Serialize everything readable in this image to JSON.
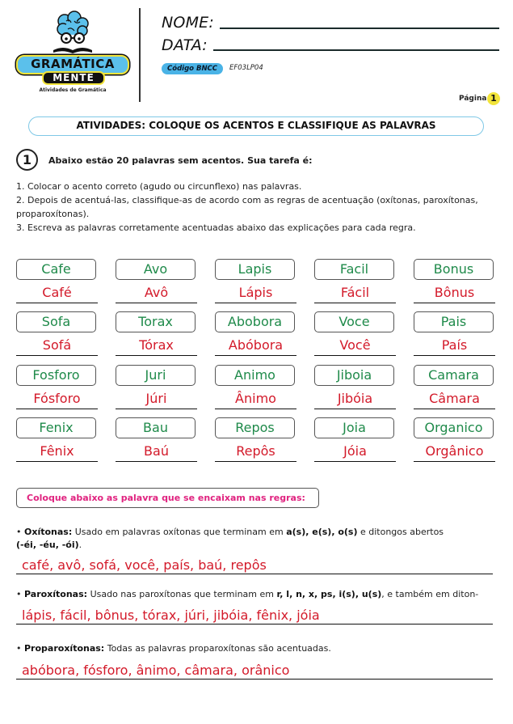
{
  "header": {
    "logo": {
      "line1": "GRAMÁTICA",
      "line2": "MENTE",
      "subtitle": "Atividades de Gramática"
    },
    "name_label": "NOME:",
    "date_label": "DATA:",
    "bncc_badge": "Código BNCC",
    "bncc_code": "EF03LP04",
    "page_label": "Página",
    "page_number": "1"
  },
  "title": "ATIVIDADES: COLOQUE OS ACENTOS E CLASSIFIQUE AS PALAVRAS",
  "step": {
    "number": "1",
    "text": "Abaixo estão 20 palavras sem acentos. Sua tarefa é:",
    "instructions": [
      "1. Colocar o acento correto (agudo ou circunflexo) nas palavras.",
      "2. Depois de acentuá-las, classifique-as de acordo com as regras de acentuação (oxítonas, paroxítonas, proparoxítonas).",
      "3. Escreva as palavras corretamente acentuadas abaixo das explicações para cada regra."
    ]
  },
  "words": [
    {
      "plain": "Cafe",
      "accented": "Café"
    },
    {
      "plain": "Avo",
      "accented": "Avô"
    },
    {
      "plain": "Lapis",
      "accented": "Lápis"
    },
    {
      "plain": "Facil",
      "accented": "Fácil"
    },
    {
      "plain": "Bonus",
      "accented": "Bônus"
    },
    {
      "plain": "Sofa",
      "accented": "Sofá"
    },
    {
      "plain": "Torax",
      "accented": "Tórax"
    },
    {
      "plain": "Abobora",
      "accented": "Abóbora"
    },
    {
      "plain": "Voce",
      "accented": "Você"
    },
    {
      "plain": "Pais",
      "accented": "País"
    },
    {
      "plain": "Fosforo",
      "accented": "Fósforo"
    },
    {
      "plain": "Juri",
      "accented": "Júri"
    },
    {
      "plain": "Animo",
      "accented": "Ânimo"
    },
    {
      "plain": "Jiboia",
      "accented": "Jibóia"
    },
    {
      "plain": "Camara",
      "accented": "Câmara"
    },
    {
      "plain": "Fenix",
      "accented": "Fênix"
    },
    {
      "plain": "Bau",
      "accented": "Baú"
    },
    {
      "plain": "Repos",
      "accented": "Repôs"
    },
    {
      "plain": "Joia",
      "accented": "Jóia"
    },
    {
      "plain": "Organico",
      "accented": "Orgânico"
    }
  ],
  "rules_heading": "Coloque abaixo as palavra que se encaixam nas regras:",
  "rules": [
    {
      "name": "Oxítonas:",
      "parts": [
        "Usado em palavras oxítonas que terminam em ",
        "a(s), e(s), o(s)",
        " e ditongos abertos ",
        "(-éi, -éu, -ói)",
        "."
      ],
      "answer": "café, avô, sofá, você, país, baú, repôs"
    },
    {
      "name": "Paroxítonas:",
      "parts": [
        "Usado nas paroxítonas que terminam em ",
        "r, l, n, x, ps, i(s), u(s)",
        ", e também em diton-"
      ],
      "answer": "lápis, fácil, bônus, tórax, júri, jibóia, fênix, jóia"
    },
    {
      "name": "Proparoxítonas:",
      "parts": [
        "Todas as palavras proparoxítonas são acentuadas."
      ],
      "answer": "abóbora, fósforo, ânimo, câmara, orânico"
    }
  ],
  "colors": {
    "plain_word": "#1f8a4a",
    "accented_word": "#d31a2a",
    "rules_heading": "#e0227f",
    "bncc_badge": "#4ab3e6",
    "page_badge": "#f2e43a",
    "banner_border": "#7fc8e6"
  }
}
